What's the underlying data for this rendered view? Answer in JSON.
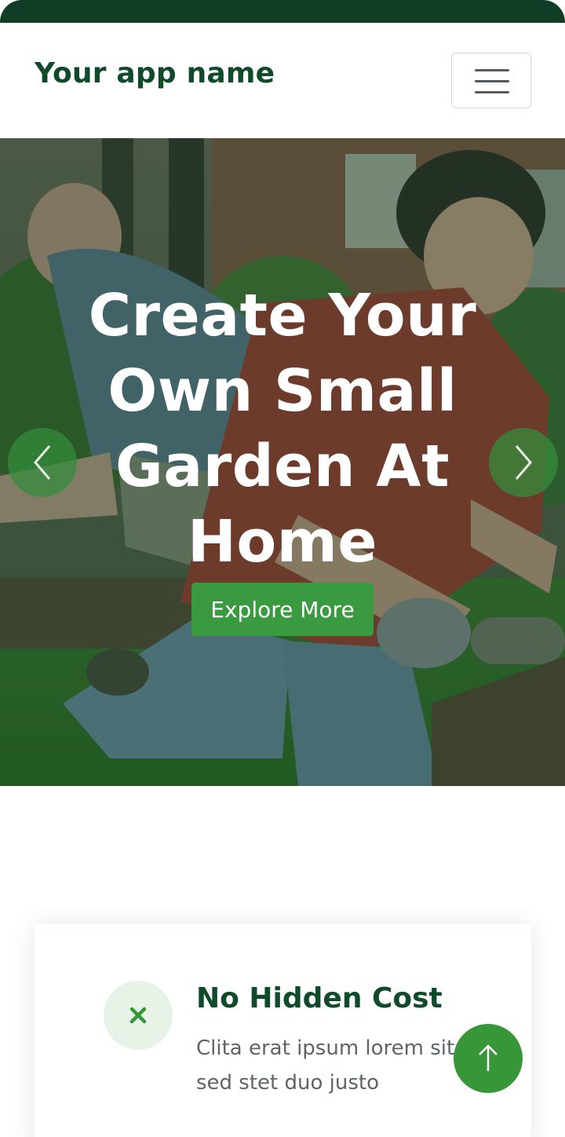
{
  "brand": {
    "name": "Your app name"
  },
  "menu": {
    "icon": "hamburger-icon"
  },
  "hero": {
    "title": "Create Your Own Small Garden At Home",
    "button_label": "Explore More",
    "prev_icon": "chevron-left-icon",
    "next_icon": "chevron-right-icon"
  },
  "feature": {
    "icon": "close-icon",
    "title": "No Hidden Cost",
    "text": "Clita erat ipsum lorem sit sed stet duo justo"
  },
  "back_to_top": {
    "icon": "arrow-up-icon"
  },
  "colors": {
    "primary_dark": "#0f4a2a",
    "accent_green": "#3a9a3f",
    "status_bar": "#0f3d26"
  }
}
